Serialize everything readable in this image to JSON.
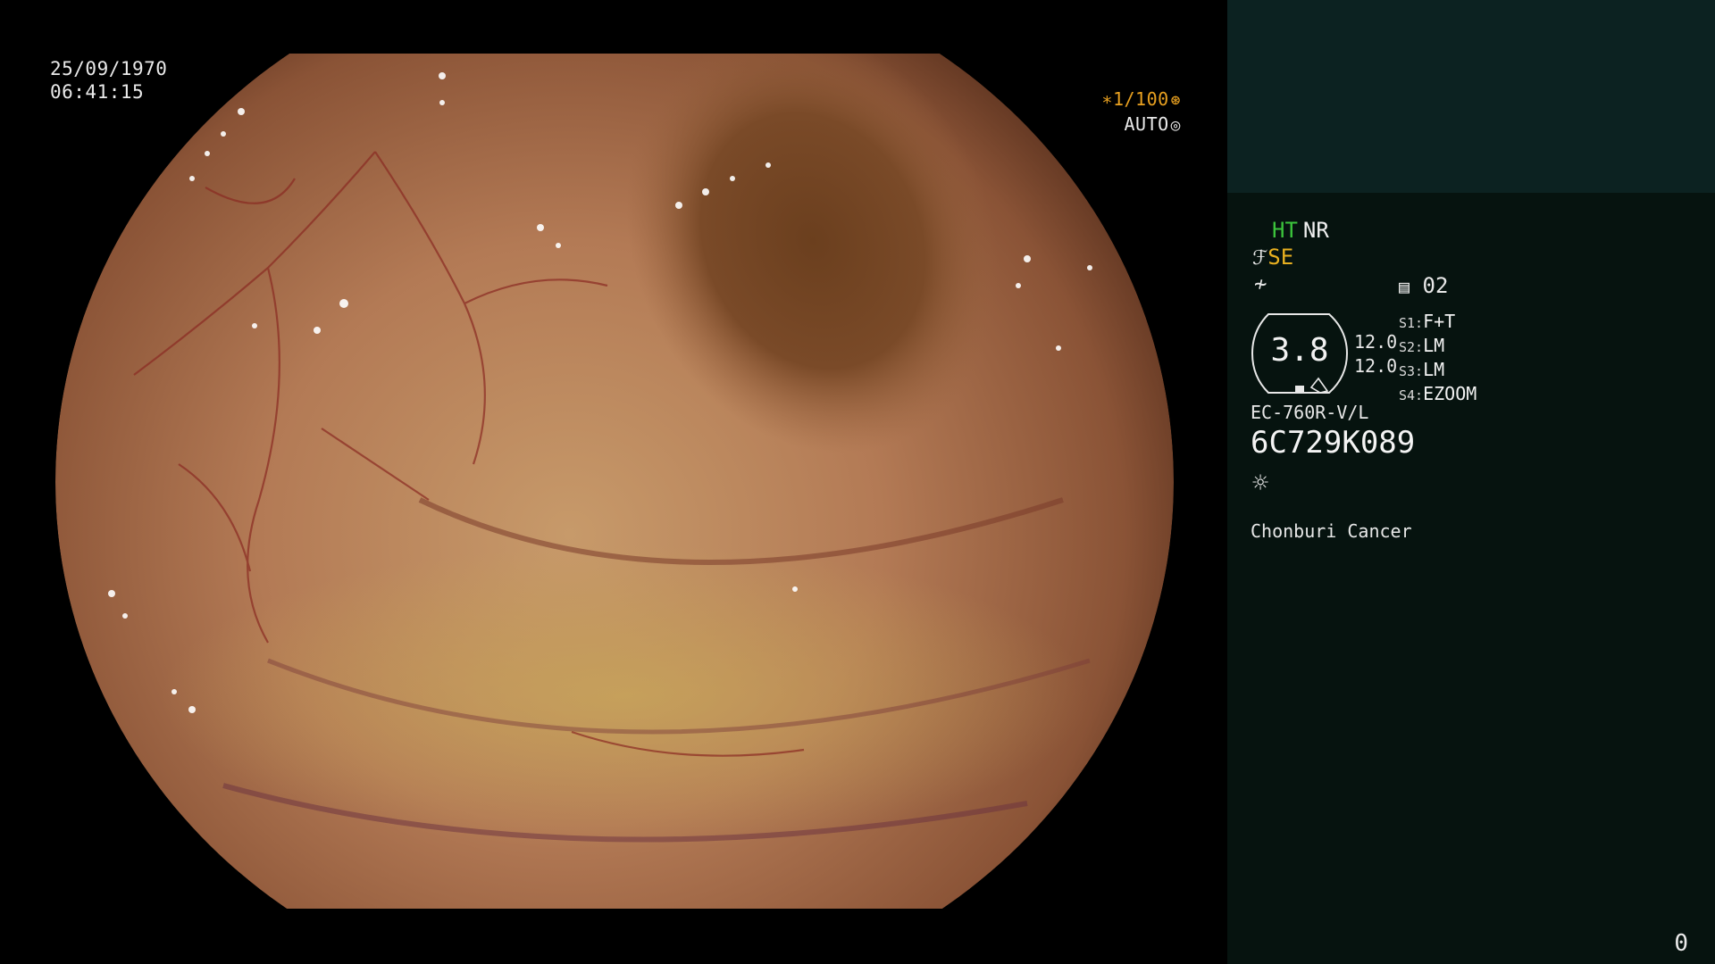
{
  "overlay": {
    "date": "25/09/1970",
    "time": "06:41:15",
    "shutter": "∗1/100",
    "shutter_icon": "aperture-icon",
    "iris": "AUTO",
    "iris_icon": "iris-icon"
  },
  "panel": {
    "ht": "HT",
    "nr": "NR",
    "se_icon": "structure-enhancement-icon",
    "se": "SE",
    "enhance_icon": "color-enhance-icon",
    "memory_icon": "memory-icon",
    "memory": "02",
    "gauge_value": "3.8",
    "scale_top": "12.0",
    "scale_bottom": "12.0",
    "switches": [
      {
        "key": "S1:",
        "value": "F+T"
      },
      {
        "key": "S2:",
        "value": "LM"
      },
      {
        "key": "S3:",
        "value": "LM"
      },
      {
        "key": "S4:",
        "value": "EZOOM"
      }
    ],
    "model": "EC-760R-V/L",
    "serial": "6C729K089",
    "lamp_icon": "lamp-icon",
    "institution": "Chonburi Cancer",
    "page_number": "0"
  },
  "colors": {
    "panel_bg": "#06130f",
    "panel_header_bg": "#0c2221",
    "ht_green": "#3cc43c",
    "se_amber": "#e8b020",
    "shutter_amber": "#e8a020"
  }
}
